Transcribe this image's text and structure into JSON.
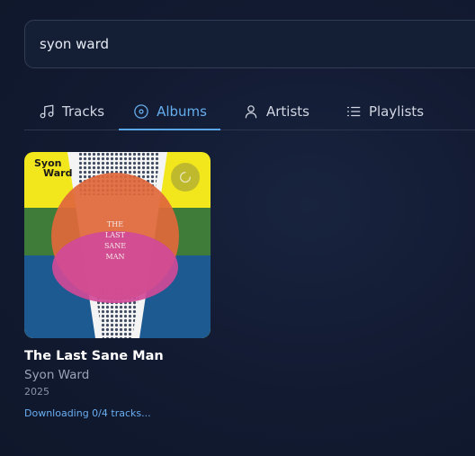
{
  "search": {
    "value": "syon ward",
    "placeholder": "Search"
  },
  "tabs": [
    {
      "label": "Tracks",
      "icon": "music-note-icon",
      "active": false
    },
    {
      "label": "Albums",
      "icon": "disc-icon",
      "active": true
    },
    {
      "label": "Artists",
      "icon": "user-icon",
      "active": false
    },
    {
      "label": "Playlists",
      "icon": "list-icon",
      "active": false
    }
  ],
  "albums": [
    {
      "title": "The Last Sane Man",
      "artist": "Syon Ward",
      "year": "2025",
      "status": "Downloading 0/4 tracks...",
      "cover_text": {
        "logo_line1": "Syon",
        "logo_line2": "Ward",
        "title_lines": [
          "THE",
          "LAST",
          "SANE",
          "MAN"
        ]
      },
      "badge_icon": "loading-spinner-icon"
    }
  ],
  "colors": {
    "background": "#121a31",
    "accent": "#5aa6ea",
    "text_primary": "#ffffff",
    "text_secondary": "#9aa3b5",
    "cover_yellow": "#f2e61c",
    "cover_green": "#3f7c39",
    "cover_blue": "#1d5a92",
    "cover_orange": "#e0673a",
    "cover_magenta": "#d04a98"
  }
}
